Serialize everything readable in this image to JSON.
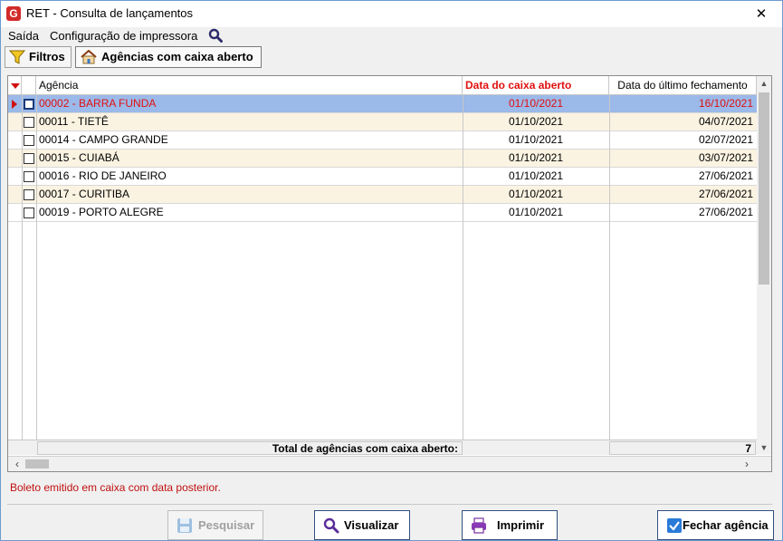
{
  "window": {
    "title": "RET - Consulta de lançamentos",
    "close_glyph": "✕",
    "app_icon_letter": "G"
  },
  "menu": {
    "items": [
      "Saída",
      "Configuração de impressora"
    ],
    "search_icon": "search-icon"
  },
  "tabs": [
    {
      "label": "Filtros",
      "icon": "funnel-icon",
      "active": false
    },
    {
      "label": "Agências com caixa aberto",
      "icon": "home-icon",
      "active": true
    }
  ],
  "grid": {
    "columns": {
      "agencia": "Agência",
      "data_caixa": "Data do caixa aberto",
      "data_fechamento": "Data do último fechamento"
    },
    "rows": [
      {
        "agencia": "00002 - BARRA FUNDA",
        "data_caixa": "01/10/2021",
        "data_fechamento": "16/10/2021",
        "checked": false,
        "selected": true
      },
      {
        "agencia": "00011 - TIETÊ",
        "data_caixa": "01/10/2021",
        "data_fechamento": "04/07/2021",
        "checked": false,
        "selected": false
      },
      {
        "agencia": "00014 - CAMPO GRANDE",
        "data_caixa": "01/10/2021",
        "data_fechamento": "02/07/2021",
        "checked": false,
        "selected": false
      },
      {
        "agencia": "00015 - CUIABÁ",
        "data_caixa": "01/10/2021",
        "data_fechamento": "03/07/2021",
        "checked": false,
        "selected": false
      },
      {
        "agencia": "00016 - RIO DE JANEIRO",
        "data_caixa": "01/10/2021",
        "data_fechamento": "27/06/2021",
        "checked": false,
        "selected": false
      },
      {
        "agencia": "00017 - CURITIBA",
        "data_caixa": "01/10/2021",
        "data_fechamento": "27/06/2021",
        "checked": false,
        "selected": false
      },
      {
        "agencia": "00019 - PORTO ALEGRE",
        "data_caixa": "01/10/2021",
        "data_fechamento": "27/06/2021",
        "checked": false,
        "selected": false
      }
    ],
    "footer": {
      "total_label": "Total de agências com caixa aberto:",
      "total_value": "7"
    }
  },
  "status": {
    "message": "Boleto emitido em caixa com data posterior."
  },
  "buttons": {
    "pesquisar": {
      "label": "Pesquisar",
      "enabled": false
    },
    "visualizar": {
      "label": "Visualizar",
      "enabled": true
    },
    "imprimir": {
      "label": "Imprimir",
      "enabled": true
    },
    "fechar_agencia": {
      "label": "Fechar agência",
      "enabled": true
    }
  },
  "colors": {
    "accent_red": "#e01010",
    "selection": "#9bb9e9",
    "alt_row": "#fbf3e2",
    "button_border": "#2f4f7f"
  }
}
